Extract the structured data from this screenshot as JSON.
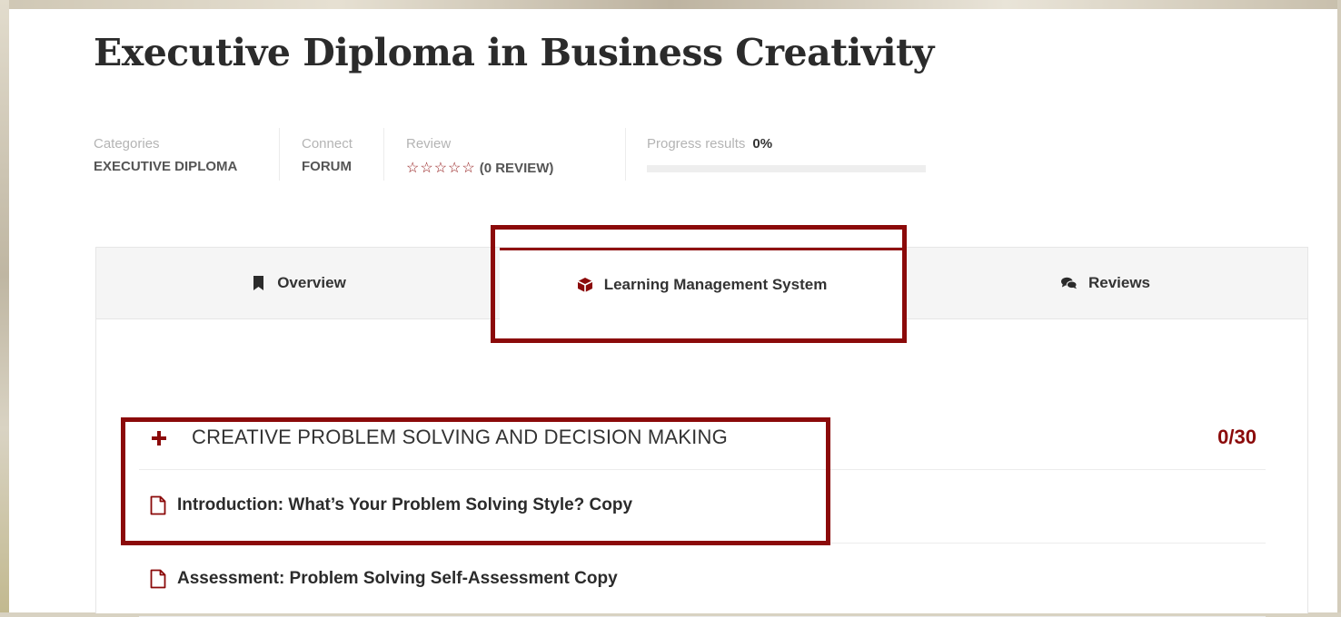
{
  "course": {
    "title": "Executive Diploma in Business Creativity"
  },
  "meta": {
    "categories_label": "Categories",
    "categories_value": "EXECUTIVE DIPLOMA",
    "connect_label": "Connect",
    "connect_value": "FORUM",
    "review_label": "Review",
    "review_stars": "☆☆☆☆☆",
    "review_rating": 0,
    "review_count": "(0 REVIEW)",
    "progress_label": "Progress results",
    "progress_value": "0%",
    "progress_fraction": 0
  },
  "tabs": [
    {
      "label": "Overview",
      "icon": "bookmark-icon",
      "active": false
    },
    {
      "label": "Learning Management System",
      "icon": "cube-icon",
      "active": true
    },
    {
      "label": "Reviews",
      "icon": "comments-icon",
      "active": false
    }
  ],
  "curriculum": {
    "section_title": "CREATIVE PROBLEM SOLVING AND DECISION MAKING",
    "section_count": "0/30",
    "section_icon": "plus-icon",
    "lessons": [
      {
        "title": "Introduction: What’s Your Problem Solving Style? Copy",
        "icon": "file-icon"
      },
      {
        "title": "Assessment: Problem Solving Self-Assessment Copy",
        "icon": "file-icon"
      }
    ]
  },
  "colors": {
    "accent": "#8b0a0a",
    "highlight_border": "#8b0a0a",
    "tabbar_bg": "#f5f5f5"
  }
}
